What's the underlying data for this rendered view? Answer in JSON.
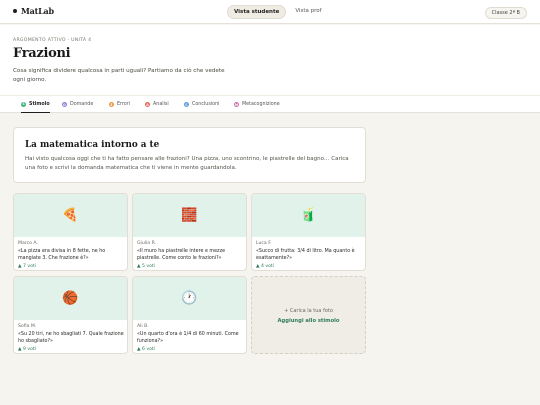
{
  "app": {
    "name": "MatLab"
  },
  "view_toggle": {
    "student": "Vista studente",
    "teacher": "Vista prof"
  },
  "class_chip": "Classe 2ª B",
  "header": {
    "eyebrow": "ARGOMENTO ATTIVO · UNITÀ 4",
    "title": "Frazioni",
    "description": "Cosa significa dividere qualcosa in parti uguali? Partiamo da ciò che vedete ogni giorno."
  },
  "tabs": [
    {
      "label": "Stimolo",
      "color": "#3bb27a",
      "letter": "S"
    },
    {
      "label": "Domande",
      "color": "#8b7bd8",
      "letter": "D"
    },
    {
      "label": "Errori",
      "color": "#e8963f",
      "letter": "E"
    },
    {
      "label": "Analisi",
      "color": "#e06b5a",
      "letter": "A"
    },
    {
      "label": "Conclusioni",
      "color": "#5b9be0",
      "letter": "C"
    },
    {
      "label": "Metacognizione",
      "color": "#d06aa5",
      "letter": "M"
    }
  ],
  "intro": {
    "title": "La matematica intorno a te",
    "text": "Hai visto qualcosa oggi che ti ha fatto pensare alle frazioni? Una pizza, uno scontrino, le piastrelle del bagno… Carica una foto e scrivi la domanda matematica che ti viene in mente guardandola."
  },
  "cards": [
    {
      "icon": "pizza-icon",
      "emoji": "🍕",
      "author": "Marco A.",
      "text": "«La pizza era divisa in 8 fette, ne ho mangiate 3. Che frazione è?»",
      "votes": "▲ 7 voti"
    },
    {
      "icon": "bricks-icon",
      "emoji": "🧱",
      "author": "Giulia R.",
      "text": "«Il muro ha piastrelle intere e mezze piastrelle. Come conto le frazioni?»",
      "votes": "▲ 5 voti"
    },
    {
      "icon": "juice-box-icon",
      "emoji": "🧃",
      "author": "Luca F.",
      "text": "«Succo di frutta: 3/4 di litro. Ma quanto è esattamente?»",
      "votes": "▲ 4 voti"
    },
    {
      "icon": "basketball-icon",
      "emoji": "🏀",
      "author": "Sofia M.",
      "text": "«Su 20 tiri, ne ho sbagliati 7. Quale frazione ho sbagliato?»",
      "votes": "▲ 9 voti"
    },
    {
      "icon": "clock-icon",
      "emoji": "🕐",
      "author": "Ali B.",
      "text": "«Un quarto d'ora è 1/4 di 60 minuti. Come funziona?»",
      "votes": "▲ 6 voti"
    }
  ],
  "upload": {
    "hint": "+ Carica la tua foto",
    "action": "Aggiungi allo stimolo"
  }
}
